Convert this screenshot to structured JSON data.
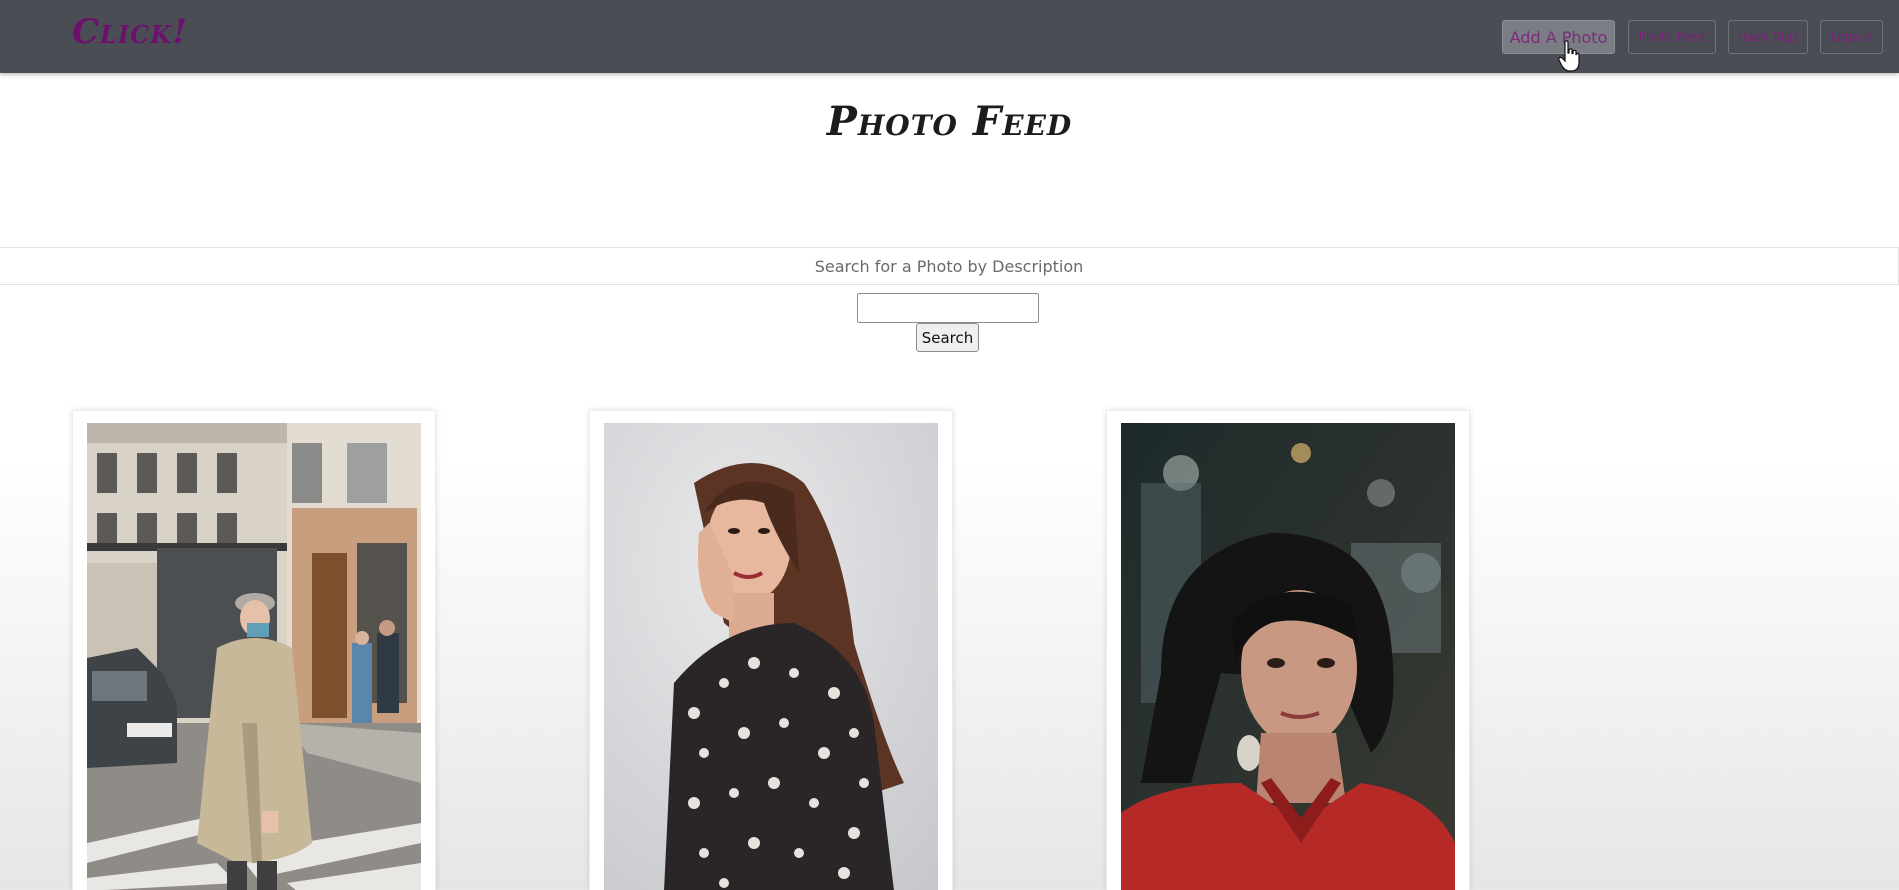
{
  "navbar": {
    "brand": "Click!",
    "buttons": [
      {
        "label": "Add A Photo"
      },
      {
        "label": "Photo Feed"
      },
      {
        "label": "Hash Tags"
      },
      {
        "label": "Logout"
      }
    ]
  },
  "page": {
    "title": "Photo Feed"
  },
  "search": {
    "label": "Search for a Photo by Description",
    "input_value": "",
    "button_label": "Search"
  },
  "photos": [
    {
      "subject": "man-in-trench-coat-street-photo"
    },
    {
      "subject": "woman-in-floral-dress-portrait"
    },
    {
      "subject": "woman-in-red-top-portrait"
    }
  ],
  "colors": {
    "navbar_bg": "#4a4d54",
    "brand": "#6e0f6e",
    "nav_text": "#7e1f7e"
  }
}
